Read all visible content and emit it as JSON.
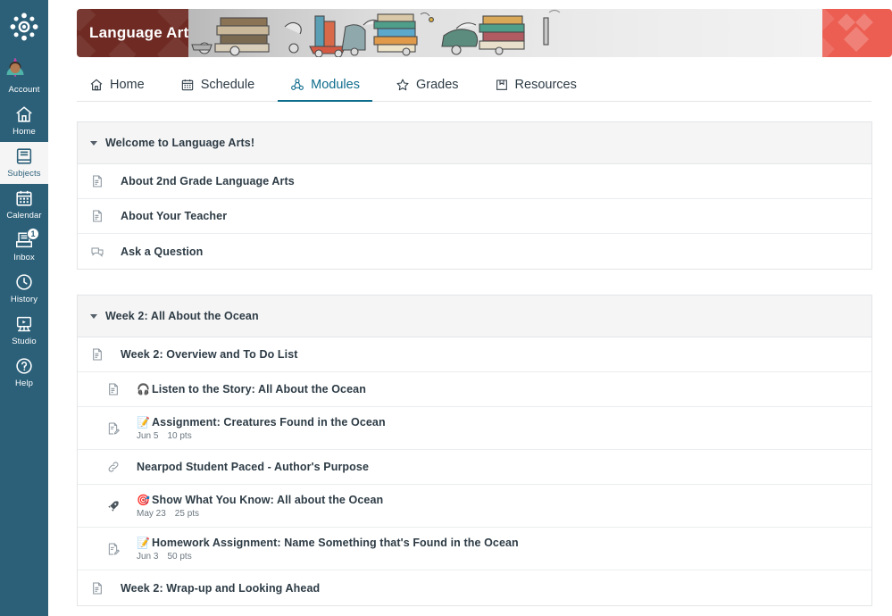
{
  "global_nav": {
    "logo": "canvas-logo",
    "items": [
      {
        "label": "Account",
        "icon": "avatar-icon",
        "active": false,
        "badge": null
      },
      {
        "label": "Home",
        "icon": "home-icon",
        "active": false,
        "badge": null
      },
      {
        "label": "Subjects",
        "icon": "book-icon",
        "active": true,
        "badge": null
      },
      {
        "label": "Calendar",
        "icon": "calendar-icon",
        "active": false,
        "badge": null
      },
      {
        "label": "Inbox",
        "icon": "inbox-icon",
        "active": false,
        "badge": "1"
      },
      {
        "label": "History",
        "icon": "clock-icon",
        "active": false,
        "badge": null
      },
      {
        "label": "Studio",
        "icon": "studio-icon",
        "active": false,
        "badge": null
      },
      {
        "label": "Help",
        "icon": "question-icon",
        "active": false,
        "badge": null
      }
    ]
  },
  "banner": {
    "course_title": "Language Arts",
    "left_color": "#6E2A23",
    "right_color": "#EC5E52"
  },
  "tabs": [
    {
      "label": "Home",
      "icon": "home-icon",
      "active": false
    },
    {
      "label": "Schedule",
      "icon": "calendar-icon",
      "active": false
    },
    {
      "label": "Modules",
      "icon": "modules-icon",
      "active": true
    },
    {
      "label": "Grades",
      "icon": "star-icon",
      "active": false
    },
    {
      "label": "Resources",
      "icon": "folder-icon",
      "active": false
    }
  ],
  "modules": [
    {
      "title": "Welcome to Language Arts!",
      "expanded": true,
      "items": [
        {
          "title": "About 2nd Grade Language Arts",
          "icon": "page-icon",
          "indent": 1,
          "emoji": "",
          "due": "",
          "points": ""
        },
        {
          "title": "About Your Teacher",
          "icon": "page-icon",
          "indent": 1,
          "emoji": "",
          "due": "",
          "points": ""
        },
        {
          "title": "Ask a Question",
          "icon": "discussion-icon",
          "indent": 1,
          "emoji": "",
          "due": "",
          "points": ""
        }
      ]
    },
    {
      "title": "Week 2: All About the Ocean",
      "expanded": true,
      "items": [
        {
          "title": "Week 2: Overview and To Do List",
          "icon": "page-icon",
          "indent": 1,
          "emoji": "",
          "due": "",
          "points": ""
        },
        {
          "title": "Listen to the Story: All About the Ocean",
          "icon": "page-icon",
          "indent": 2,
          "emoji": "🎧",
          "due": "",
          "points": ""
        },
        {
          "title": "Assignment: Creatures Found in the Ocean",
          "icon": "assignment-icon",
          "indent": 2,
          "emoji": "📝",
          "due": "Jun 5",
          "points": "10 pts"
        },
        {
          "title": "Nearpod Student Paced - Author's Purpose",
          "icon": "link-icon",
          "indent": 2,
          "emoji": "",
          "due": "",
          "points": ""
        },
        {
          "title": "Show What You Know: All about the Ocean",
          "icon": "quiz-icon",
          "indent": 2,
          "emoji": "🎯",
          "due": "May 23",
          "points": "25 pts"
        },
        {
          "title": "Homework Assignment: Name Something that's Found in the Ocean",
          "icon": "assignment-icon",
          "indent": 2,
          "emoji": "📝",
          "due": "Jun 3",
          "points": "50 pts"
        },
        {
          "title": "Week 2: Wrap-up and Looking Ahead",
          "icon": "page-icon",
          "indent": 1,
          "emoji": "",
          "due": "",
          "points": ""
        }
      ]
    }
  ]
}
